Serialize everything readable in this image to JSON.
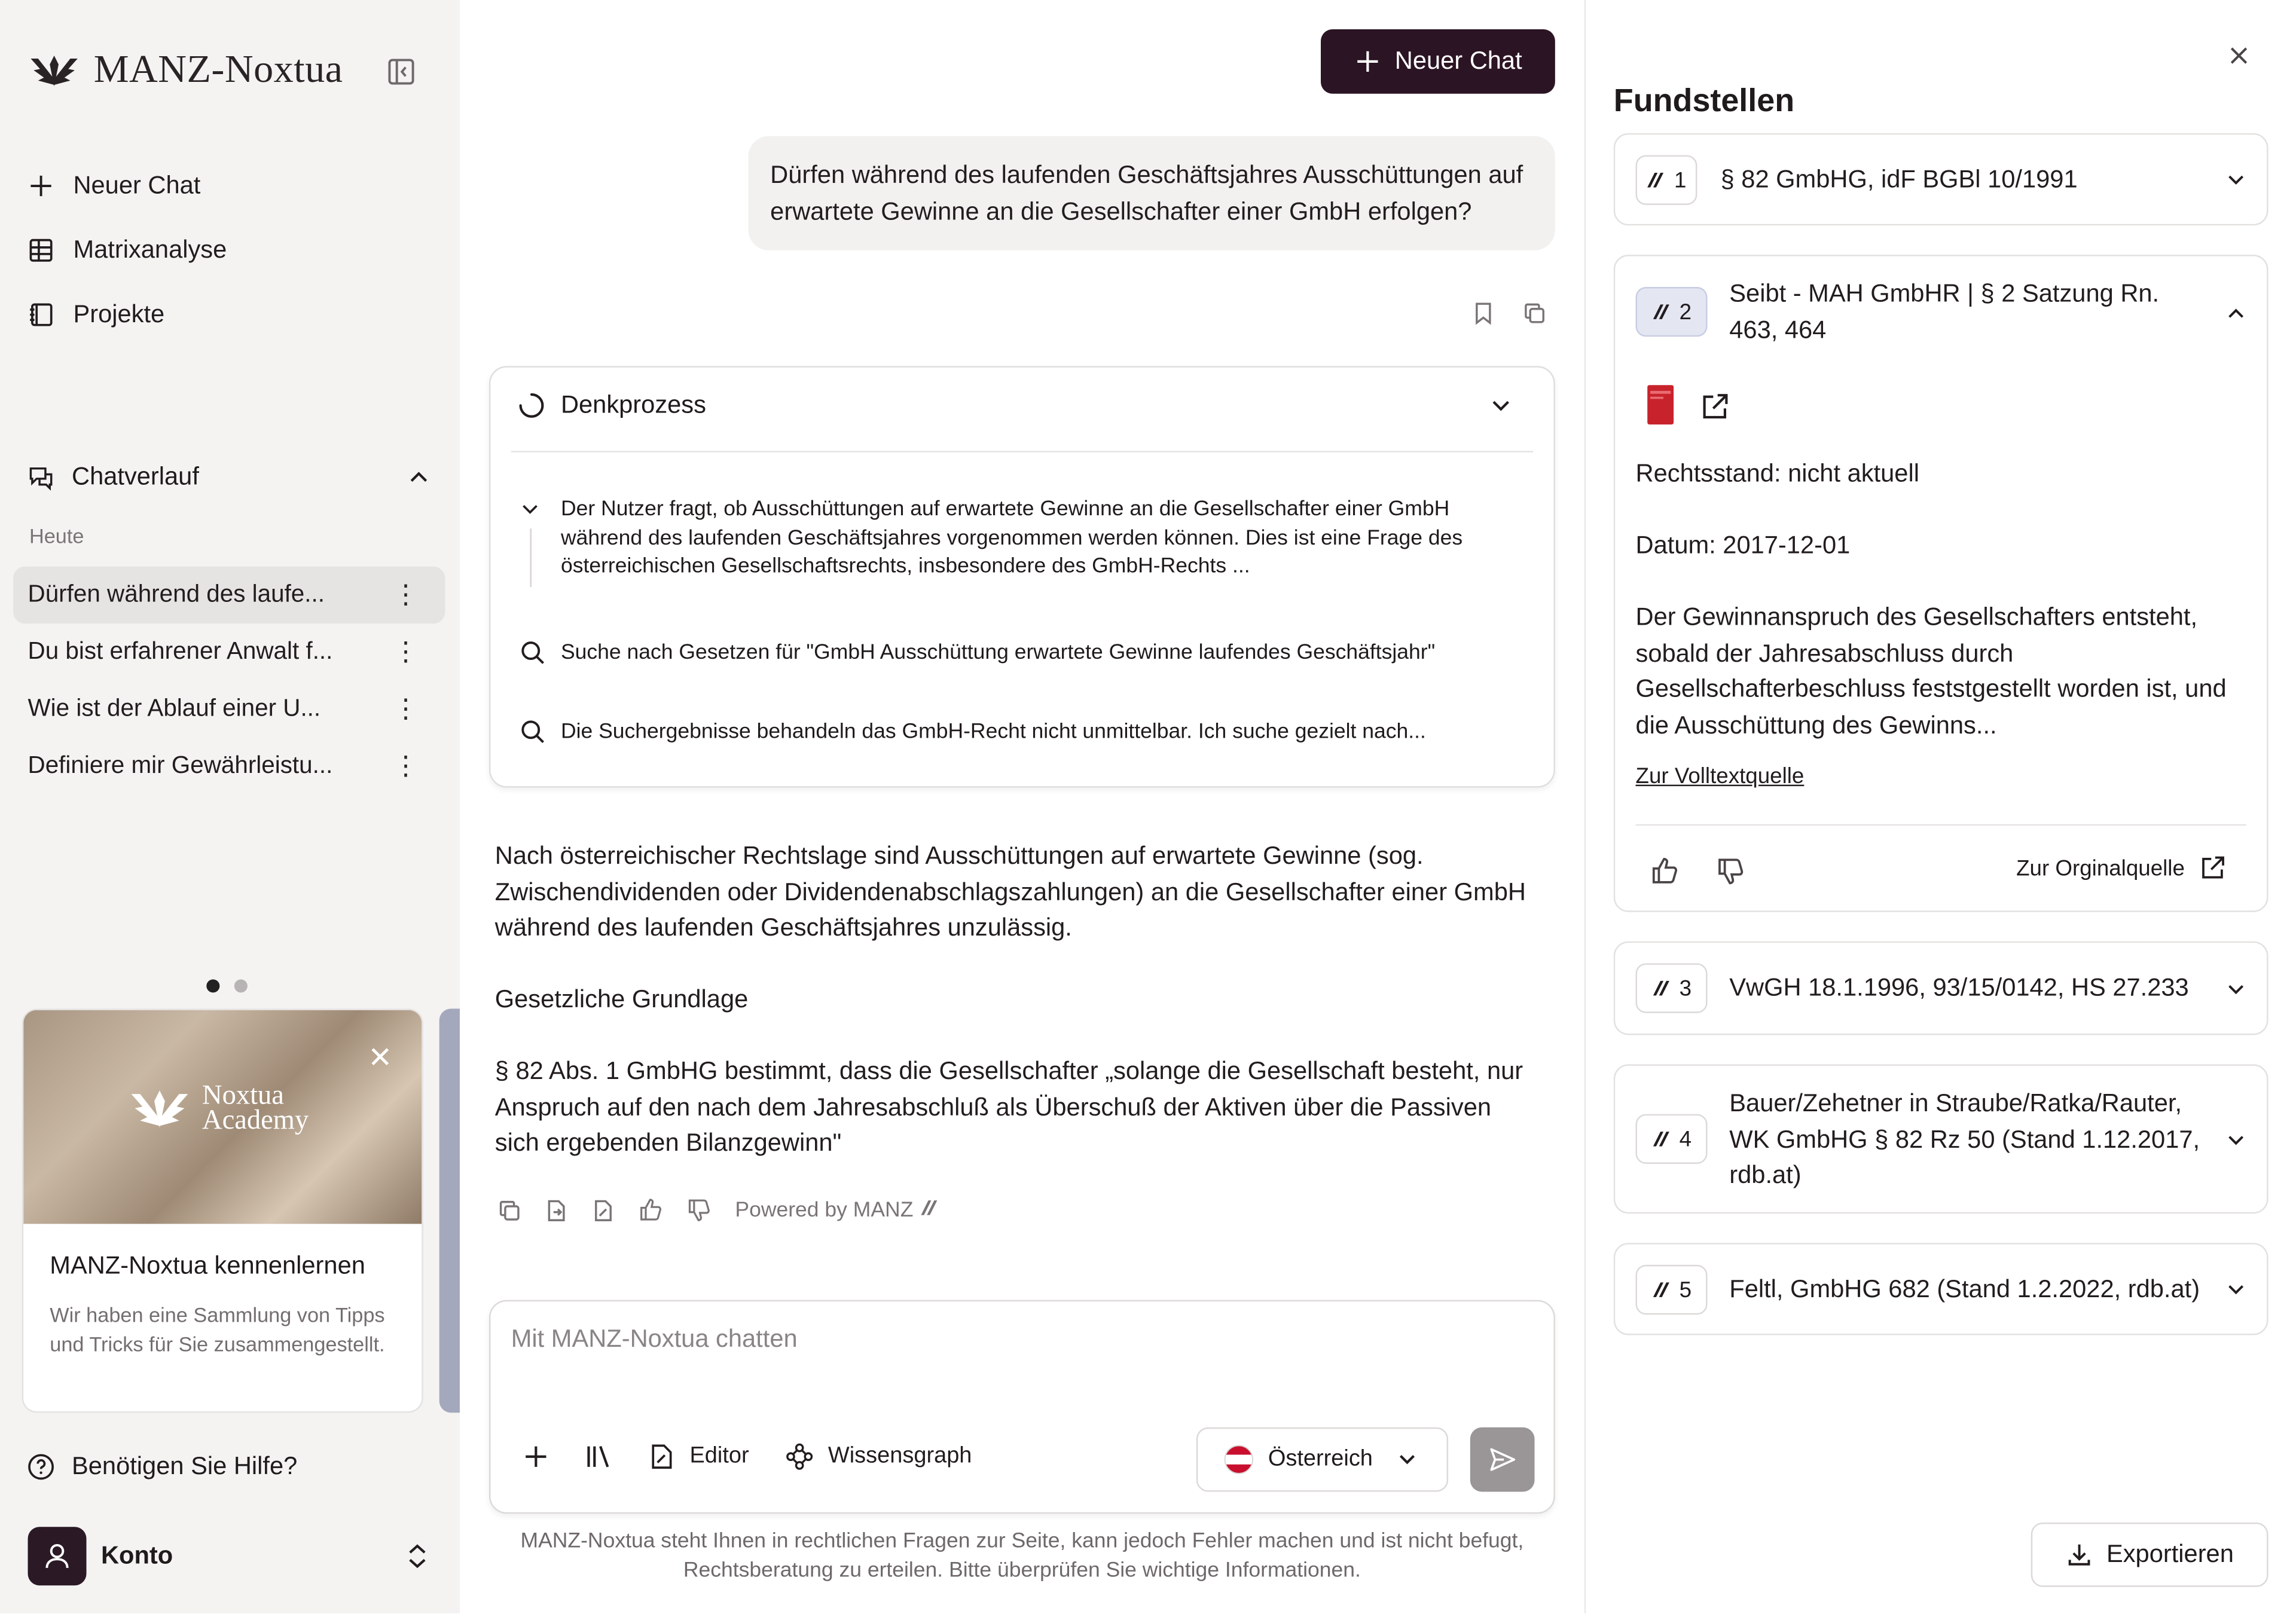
{
  "sidebar": {
    "brand": "MANZ-Noxtua",
    "nav": [
      {
        "label": "Neuer Chat",
        "icon": "plus-icon"
      },
      {
        "label": "Matrixanalyse",
        "icon": "table-icon"
      },
      {
        "label": "Projekte",
        "icon": "notebook-icon"
      }
    ],
    "history_title": "Chatverlauf",
    "history_group": "Heute",
    "history": [
      "Dürfen während des laufe...",
      "Du bist erfahrener Anwalt f...",
      "Wie ist der Ablauf einer U...",
      "Definiere mir Gewährleistu..."
    ],
    "card": {
      "logo_line1": "Noxtua",
      "logo_line2": "Academy",
      "title": "MANZ-Noxtua kennenlernen",
      "desc": "Wir haben eine Sammlung von Tipps und Tricks für Sie zusammengestellt."
    },
    "help": "Benötigen Sie Hilfe?",
    "account": "Konto"
  },
  "main": {
    "new_chat": "Neuer Chat",
    "user_message": "Dürfen während des laufenden Geschäftsjahres Ausschüttungen auf erwartete Gewinne an die Gesellschafter einer GmbH erfolgen?",
    "think": {
      "title": "Denkprozess",
      "step1": "Der Nutzer fragt, ob Ausschüttungen auf erwartete Gewinne an die Gesellschafter einer GmbH während des laufenden Geschäftsjahres vorgenommen werden können. Dies ist eine Frage des österreichischen Gesellschaftsrechts, insbesondere des GmbH-Rechts ...",
      "step2": "Suche nach Gesetzen für \"GmbH Ausschüttung erwartete Gewinne laufendes Geschäftsjahr\"",
      "step3": "Die Suchergebnisse behandeln das GmbH-Recht nicht unmittelbar. Ich suche gezielt nach..."
    },
    "answer": [
      "Nach österreichischer Rechtslage sind Ausschüttungen auf erwartete Gewinne (sog. Zwischendividenden oder Dividendenabschlagszahlungen) an die Gesellschafter einer GmbH während des laufenden Geschäftsjahres unzulässig.",
      "Gesetzliche Grundlage",
      "§ 82 Abs. 1 GmbHG bestimmt, dass die Gesellschafter „solange die Gesellschaft besteht, nur Anspruch auf den nach dem Jahresabschluß als Überschuß der Aktiven über die Passiven sich ergebenden Bilanzgewinn\""
    ],
    "powered_by": "Powered by MANZ",
    "composer": {
      "placeholder": "Mit MANZ-Noxtua chatten",
      "editor": "Editor",
      "graph": "Wissensgraph",
      "country": "Österreich"
    },
    "disclaimer": "MANZ-Noxtua steht Ihnen in rechtlichen Fragen zur Seite, kann jedoch Fehler machen und ist nicht befugt, Rechtsberatung zu erteilen. Bitte überprüfen Sie wichtige Informationen."
  },
  "panel": {
    "title": "Fundstellen",
    "sources": [
      {
        "num": "1",
        "title": "§ 82 GmbHG, idF BGBl 10/1991"
      },
      {
        "num": "2",
        "title": "Seibt - MAH GmbHR | § 2 Satzung Rn. 463, 464",
        "status": "Rechtsstand: nicht aktuell",
        "date": "Datum: 2017-12-01",
        "excerpt": "Der Gewinnanspruch des Gesellschafters entsteht, sobald der Jahresabschluss durch Gesellschafterbeschluss feststgestellt worden ist, und die Ausschüttung des Gewinns...",
        "fulltext": "Zur Volltextquelle",
        "original": "Zur Orginalquelle"
      },
      {
        "num": "3",
        "title": "VwGH 18.1.1996, 93/15/0142, HS 27.233"
      },
      {
        "num": "4",
        "title": "Bauer/Zehetner in Straube/Ratka/Rauter, WK GmbHG § 82 Rz 50 (Stand 1.12.2017, rdb.at)"
      },
      {
        "num": "5",
        "title": "Feltl, GmbHG 682 (Stand 1.2.2022, rdb.at)"
      }
    ],
    "export": "Exportieren"
  },
  "colors": {
    "accent": "#2b1423",
    "sidebar_bg": "#f4f3f2",
    "flag_red": "#c8102e"
  }
}
